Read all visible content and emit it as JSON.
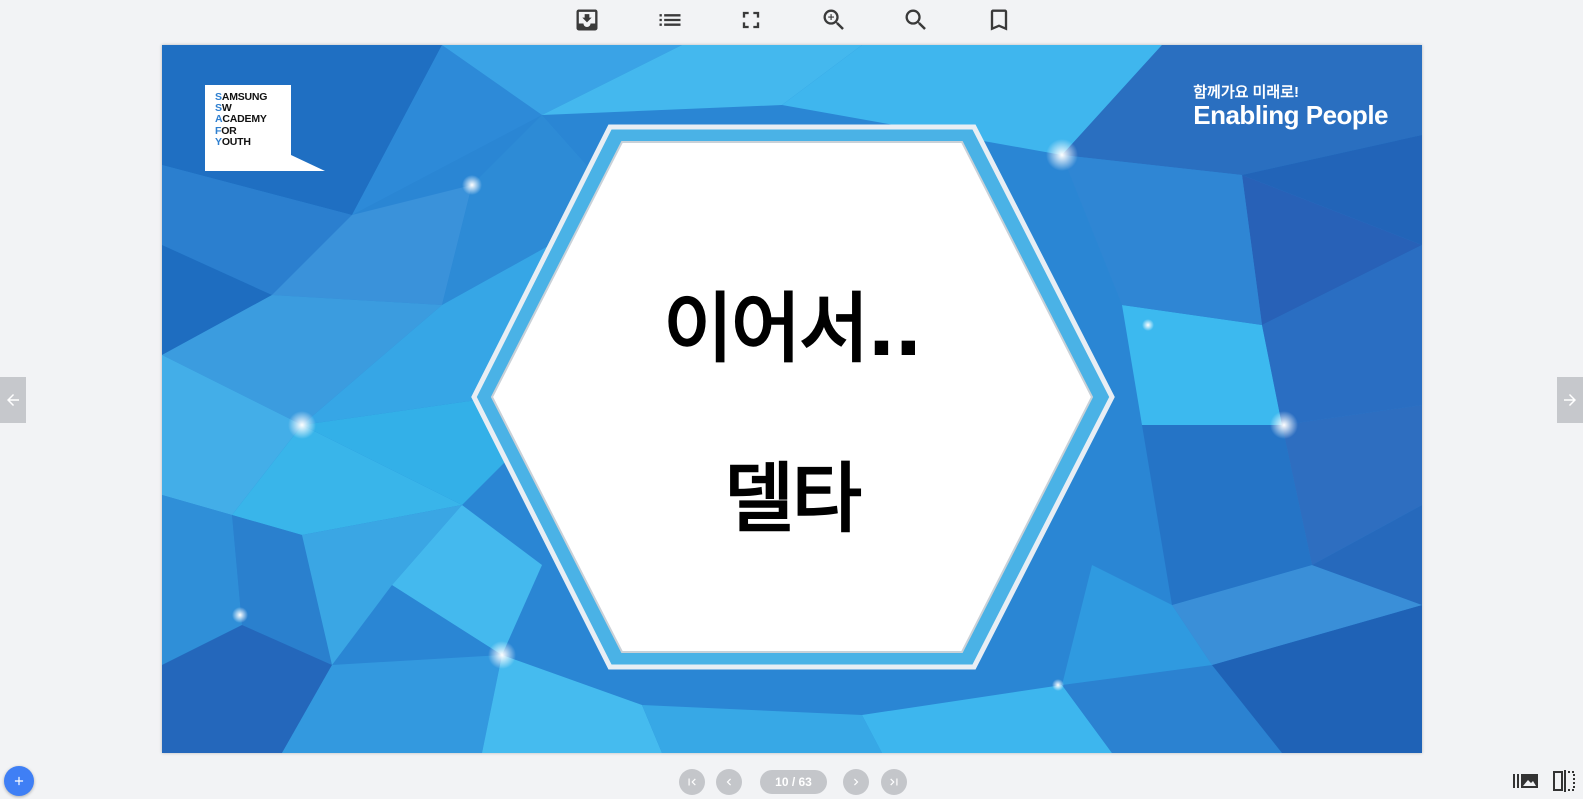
{
  "toolbar": {
    "icons": [
      "download-icon",
      "outline-list-icon",
      "fullscreen-icon",
      "zoom-in-icon",
      "search-icon",
      "bookmark-icon"
    ]
  },
  "slide": {
    "logo": {
      "lines": [
        {
          "initial": "S",
          "rest": "AMSUNG"
        },
        {
          "initial": "S",
          "rest": "W"
        },
        {
          "initial": "A",
          "rest": "CADEMY"
        },
        {
          "initial": "F",
          "rest": "OR"
        },
        {
          "initial": "Y",
          "rest": "OUTH"
        }
      ]
    },
    "brand": {
      "subtitle": "함께가요 미래로!",
      "title": "Enabling People"
    },
    "title_line1": "이어서..",
    "title_line2": "델타"
  },
  "navigation": {
    "page_indicator": "10 / 63",
    "current_page": 10,
    "total_pages": 63
  },
  "colors": {
    "accent": "#3f7ff5",
    "background": "#f2f3f5",
    "control_gray": "#c4c6ca",
    "slide_blue": "#2f8fd8"
  }
}
